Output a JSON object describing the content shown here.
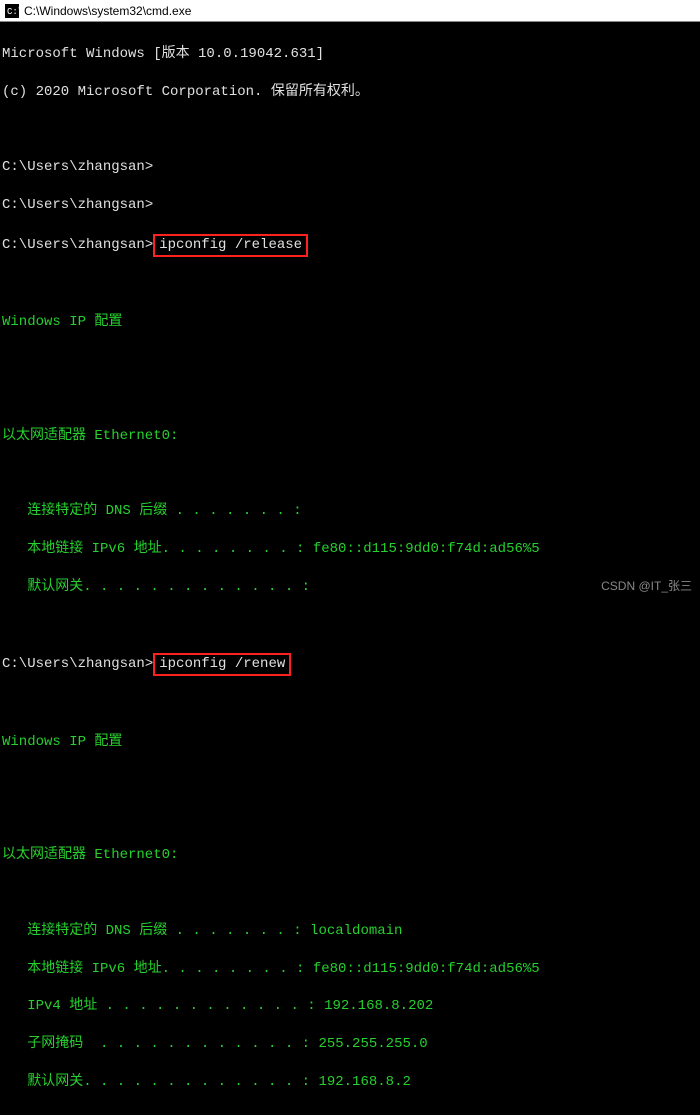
{
  "window": {
    "title": "C:\\Windows\\system32\\cmd.exe"
  },
  "header": {
    "version_line": "Microsoft Windows [版本 10.0.19042.631]",
    "copyright": "(c) 2020 Microsoft Corporation. 保留所有权利。"
  },
  "prompt": "C:\\Users\\zhangsan>",
  "cmd1": "ipconfig /release",
  "ip_heading": "Windows IP 配置",
  "adapter_heading": "以太网适配器 Ethernet0:",
  "release": {
    "dns_suffix_label": "   连接特定的 DNS 后缀 . . . . . . . :",
    "ipv6_label": "   本地链接 IPv6 地址. . . . . . . . : ",
    "ipv6_value": "fe80::d115:9dd0:f74d:ad56%5",
    "gateway_label": "   默认网关. . . . . . . . . . . . . :"
  },
  "cmd2": "ipconfig /renew",
  "renew": {
    "dns_suffix_label": "   连接特定的 DNS 后缀 . . . . . . . : ",
    "dns_suffix_value": "localdomain",
    "ipv6_label": "   本地链接 IPv6 地址. . . . . . . . : ",
    "ipv6_value": "fe80::d115:9dd0:f74d:ad56%5",
    "ipv4_label": "   IPv4 地址 . . . . . . . . . . . . : ",
    "ipv4_value": "192.168.8.202",
    "subnet_label": "   子网掩码  . . . . . . . . . . . . : ",
    "subnet_value": "255.255.255.0",
    "gateway_label": "   默认网关. . . . . . . . . . . . . : ",
    "gateway_value": "192.168.8.2"
  },
  "watermark": "CSDN @IT_张三"
}
